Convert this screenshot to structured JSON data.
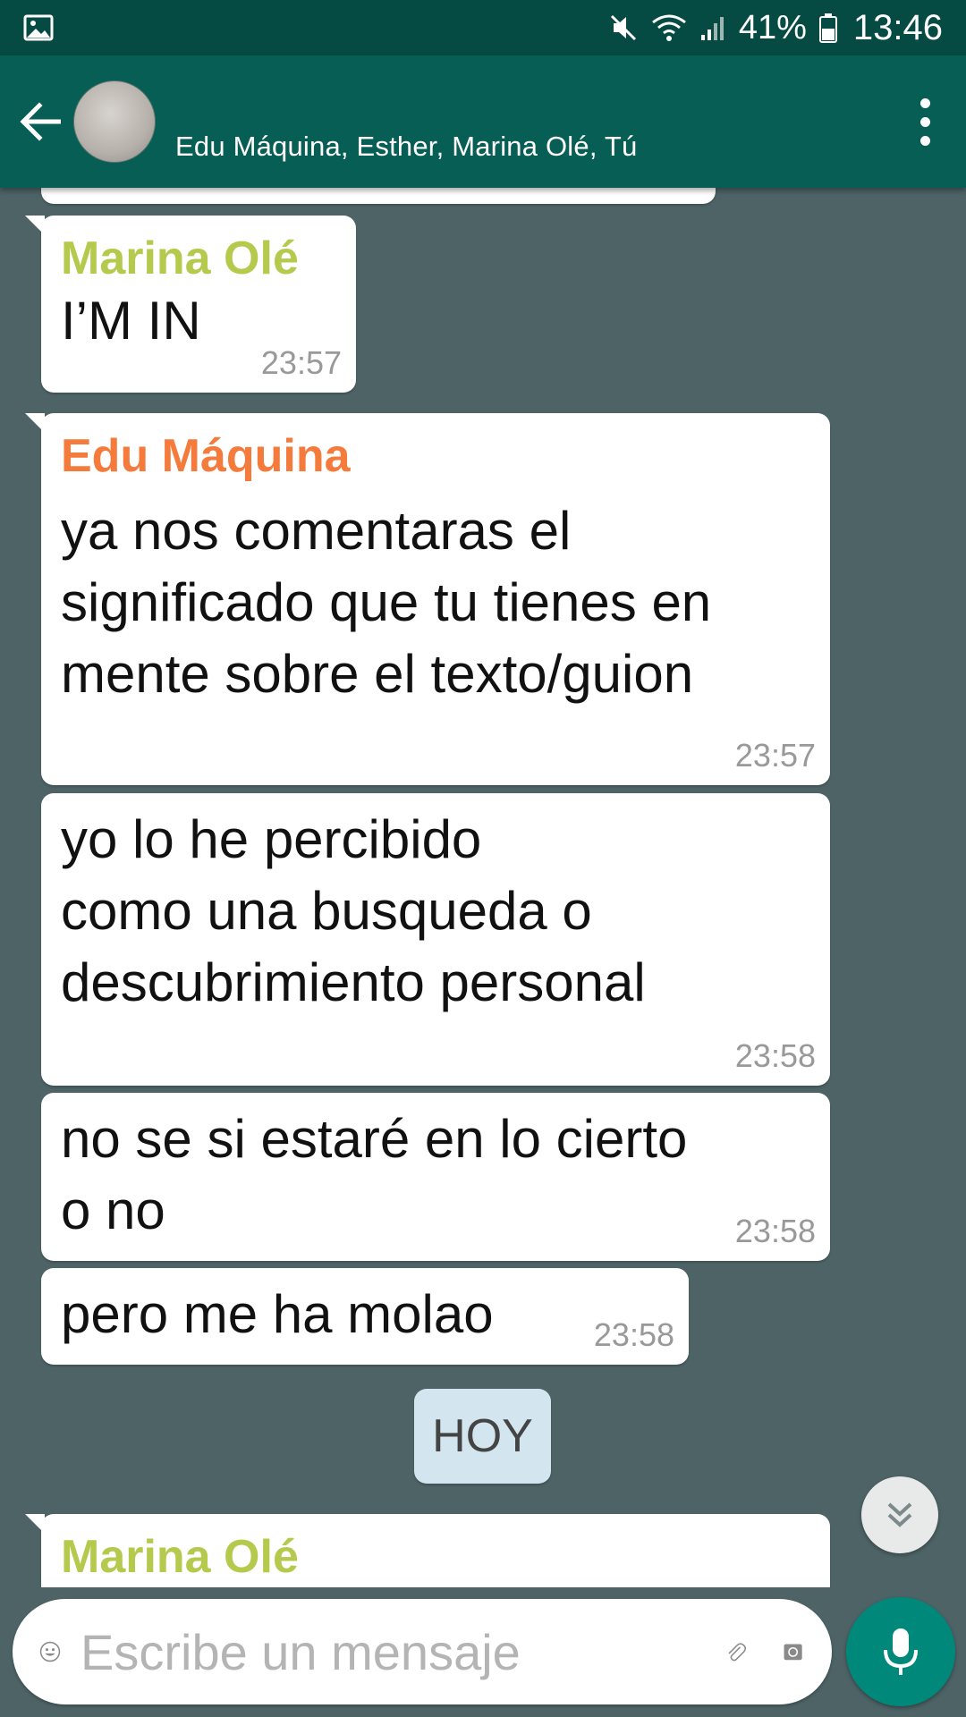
{
  "status_bar": {
    "battery_percent": "41%",
    "time": "13:46",
    "icons": [
      "image-icon",
      "mute-icon",
      "wifi-icon",
      "signal-icon",
      "battery-icon"
    ]
  },
  "header": {
    "participants": "Edu Máquina, Esther, Marina Olé, Tú",
    "icons": [
      "back-arrow-icon",
      "group-avatar",
      "more-vert-icon"
    ]
  },
  "colors": {
    "header": "#075e54",
    "status_bar": "#054b44",
    "chat_background": "#4d6366",
    "sender_marina": "#b5c94d",
    "sender_edu": "#f47b3c",
    "date_chip": "#d3e6ef",
    "mic_button": "#00897b"
  },
  "messages": [
    {
      "sender": "Marina Olé",
      "text": "I’M IN",
      "time": "23:57"
    },
    {
      "sender": "Edu Máquina",
      "text": "ya nos comentaras el\nsignificado que tu tienes en\nmente sobre el texto/guion",
      "time": "23:57"
    },
    {
      "sender": "",
      "text": "yo lo he percibido\ncomo una busqueda o\ndescubrimiento personal",
      "time": "23:58"
    },
    {
      "sender": "",
      "text": "no se si estaré en lo cierto\no no",
      "time": "23:58"
    },
    {
      "sender": "",
      "text": "pero me ha molao",
      "time": "23:58"
    }
  ],
  "date_separator": "HOY",
  "next_message": {
    "sender": "Marina Olé"
  },
  "composer": {
    "placeholder": "Escribe un mensaje",
    "icons": [
      "emoji-icon",
      "attach-icon",
      "camera-icon",
      "mic-icon"
    ]
  }
}
